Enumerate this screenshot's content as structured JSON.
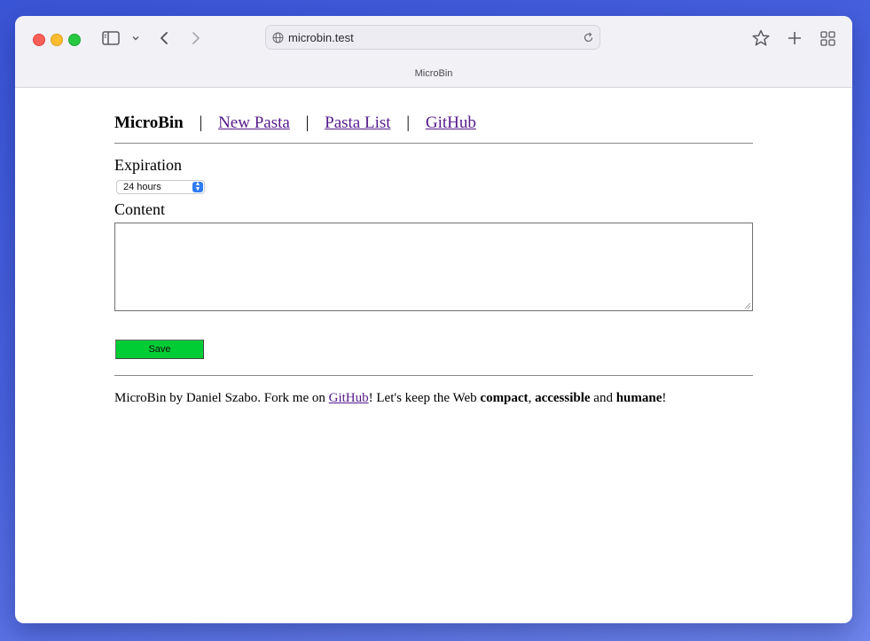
{
  "browser": {
    "url": "microbin.test",
    "tab_title": "MicroBin"
  },
  "nav": {
    "brand": "MicroBin",
    "separator": "|",
    "links": [
      "New Pasta",
      "Pasta List",
      "GitHub"
    ]
  },
  "form": {
    "expiration_label": "Expiration",
    "expiration_value": "24 hours",
    "content_label": "Content",
    "content_value": "",
    "save_label": "Save",
    "save_color": "#00cc33"
  },
  "footer": {
    "part1": "MicroBin by Daniel Szabo. Fork me on ",
    "link": "GitHub",
    "part2": "! Let's keep the Web ",
    "bold1": "compact",
    "comma": ", ",
    "bold2": "accessible",
    "and": " and ",
    "bold3": "humane",
    "end": "!"
  },
  "icons": [
    "sidebar-icon",
    "chevron-down-icon",
    "back-icon",
    "forward-icon",
    "globe-icon",
    "reload-icon",
    "star-icon",
    "plus-icon",
    "grid-icon"
  ],
  "colors": {
    "link": "#551a8b",
    "accent": "#2f7bf5"
  }
}
